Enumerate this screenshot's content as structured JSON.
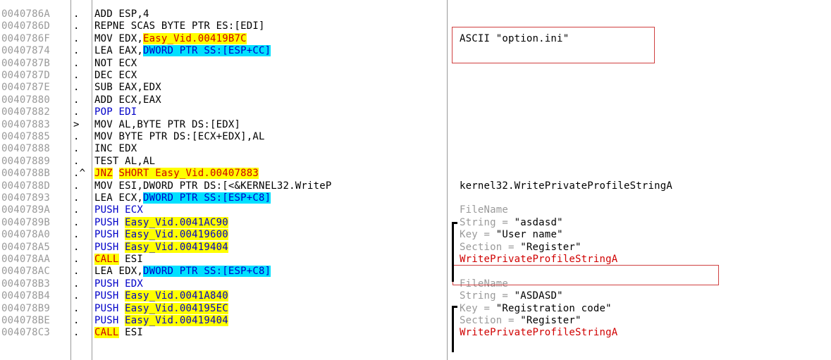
{
  "rows": [
    {
      "addr": "0040786A",
      "mark": ".",
      "parts": [
        {
          "t": "ADD ESP,4"
        }
      ],
      "comment": []
    },
    {
      "addr": "0040786D",
      "mark": ".",
      "parts": [
        {
          "t": "REPNE SCAS BYTE PTR ES:[EDI]"
        }
      ],
      "comment": []
    },
    {
      "addr": "0040786F",
      "mark": ".",
      "parts": [
        {
          "t": "MOV EDX,"
        },
        {
          "t": "Easy_Vid.00419B7C",
          "c": "hl-red"
        }
      ],
      "comment": [
        {
          "t": "ASCII \"option.ini\""
        }
      ]
    },
    {
      "addr": "00407874",
      "mark": ".",
      "parts": [
        {
          "t": "LEA EAX,"
        },
        {
          "t": "DWORD PTR SS:[ESP+CC]",
          "c": "hl-c"
        }
      ],
      "comment": []
    },
    {
      "addr": "0040787B",
      "mark": ".",
      "parts": [
        {
          "t": "NOT ECX"
        }
      ],
      "comment": []
    },
    {
      "addr": "0040787D",
      "mark": ".",
      "parts": [
        {
          "t": "DEC ECX"
        }
      ],
      "comment": []
    },
    {
      "addr": "0040787E",
      "mark": ".",
      "parts": [
        {
          "t": "SUB EAX,EDX"
        }
      ],
      "comment": []
    },
    {
      "addr": "00407880",
      "mark": ".",
      "parts": [
        {
          "t": "ADD ECX,EAX"
        }
      ],
      "comment": []
    },
    {
      "addr": "00407882",
      "mark": ".",
      "parts": [
        {
          "t": "POP EDI",
          "c": "blue"
        }
      ],
      "comment": []
    },
    {
      "addr": "00407883",
      "mark": ">",
      "parts": [
        {
          "t": "MOV AL,BYTE PTR DS:[EDX]"
        }
      ],
      "comment": []
    },
    {
      "addr": "00407885",
      "mark": ".",
      "parts": [
        {
          "t": "MOV BYTE PTR DS:[ECX+EDX],AL"
        }
      ],
      "comment": []
    },
    {
      "addr": "00407888",
      "mark": ".",
      "parts": [
        {
          "t": "INC EDX"
        }
      ],
      "comment": []
    },
    {
      "addr": "00407889",
      "mark": ".",
      "parts": [
        {
          "t": "TEST AL,AL"
        }
      ],
      "comment": []
    },
    {
      "addr": "0040788B",
      "mark": ".^",
      "parts": [
        {
          "t": "JNZ",
          "c": "hl-red"
        },
        {
          "t": " "
        },
        {
          "t": "SHORT Easy_Vid.00407883",
          "c": "hl-red"
        }
      ],
      "comment": []
    },
    {
      "addr": "0040788D",
      "mark": ".",
      "parts": [
        {
          "t": "MOV ESI,DWORD PTR DS:[<&KERNEL32.WriteP"
        }
      ],
      "comment": [
        {
          "t": "kernel32.WritePrivateProfileStringA"
        }
      ]
    },
    {
      "addr": "00407893",
      "mark": ".",
      "parts": [
        {
          "t": "LEA ECX,"
        },
        {
          "t": "DWORD PTR SS:[ESP+C8]",
          "c": "hl-c"
        }
      ],
      "comment": []
    },
    {
      "addr": "0040789A",
      "mark": ".",
      "parts": [
        {
          "t": "PUSH ECX",
          "c": "blue"
        }
      ],
      "comment": [
        {
          "t": "FileName",
          "c": "greytxt"
        }
      ]
    },
    {
      "addr": "0040789B",
      "mark": ".",
      "parts": [
        {
          "t": "PUSH ",
          "c": "blue"
        },
        {
          "t": "Easy_Vid.0041AC90",
          "c": "hl-y"
        }
      ],
      "comment": [
        {
          "t": "String = ",
          "c": "greytxt"
        },
        {
          "t": "\"asdasd\""
        }
      ]
    },
    {
      "addr": "004078A0",
      "mark": ".",
      "parts": [
        {
          "t": "PUSH ",
          "c": "blue"
        },
        {
          "t": "Easy_Vid.00419600",
          "c": "hl-y"
        }
      ],
      "comment": [
        {
          "t": "Key = ",
          "c": "greytxt"
        },
        {
          "t": "\"User name\""
        }
      ]
    },
    {
      "addr": "004078A5",
      "mark": ".",
      "parts": [
        {
          "t": "PUSH ",
          "c": "blue"
        },
        {
          "t": "Easy_Vid.00419404",
          "c": "hl-y"
        }
      ],
      "comment": [
        {
          "t": "Section = ",
          "c": "greytxt"
        },
        {
          "t": "\"Register\""
        }
      ]
    },
    {
      "addr": "004078AA",
      "mark": ".",
      "parts": [
        {
          "t": "CALL",
          "c": "hl-red"
        },
        {
          "t": " ESI"
        }
      ],
      "comment": [
        {
          "t": "WritePrivateProfileStringA",
          "c": "redtxt"
        }
      ]
    },
    {
      "addr": "004078AC",
      "mark": ".",
      "parts": [
        {
          "t": "LEA EDX,"
        },
        {
          "t": "DWORD PTR SS:[ESP+C8]",
          "c": "hl-c"
        }
      ],
      "comment": []
    },
    {
      "addr": "004078B3",
      "mark": ".",
      "parts": [
        {
          "t": "PUSH EDX",
          "c": "blue"
        }
      ],
      "comment": [
        {
          "t": "FileName",
          "c": "greytxt"
        }
      ]
    },
    {
      "addr": "004078B4",
      "mark": ".",
      "parts": [
        {
          "t": "PUSH ",
          "c": "blue"
        },
        {
          "t": "Easy_Vid.0041A840",
          "c": "hl-y"
        }
      ],
      "comment": [
        {
          "t": "String = ",
          "c": "greytxt"
        },
        {
          "t": "\"ASDASD\""
        }
      ]
    },
    {
      "addr": "004078B9",
      "mark": ".",
      "parts": [
        {
          "t": "PUSH ",
          "c": "blue"
        },
        {
          "t": "Easy_Vid.004195EC",
          "c": "hl-y"
        }
      ],
      "comment": [
        {
          "t": "Key = ",
          "c": "greytxt"
        },
        {
          "t": "\"Registration code\""
        }
      ]
    },
    {
      "addr": "004078BE",
      "mark": ".",
      "parts": [
        {
          "t": "PUSH ",
          "c": "blue"
        },
        {
          "t": "Easy_Vid.00419404",
          "c": "hl-y"
        }
      ],
      "comment": [
        {
          "t": "Section = ",
          "c": "greytxt"
        },
        {
          "t": "\"Register\""
        }
      ]
    },
    {
      "addr": "004078C3",
      "mark": ".",
      "parts": [
        {
          "t": "CALL",
          "c": "hl-red"
        },
        {
          "t": " ESI"
        }
      ],
      "comment": [
        {
          "t": "WritePrivateProfileStringA",
          "c": "redtxt"
        }
      ]
    }
  ],
  "colors": {
    "address": "#9a9a9a",
    "highlight_yellow": "#ffff00",
    "highlight_cyan": "#00e0ff",
    "annotation_box": "#d04040"
  }
}
